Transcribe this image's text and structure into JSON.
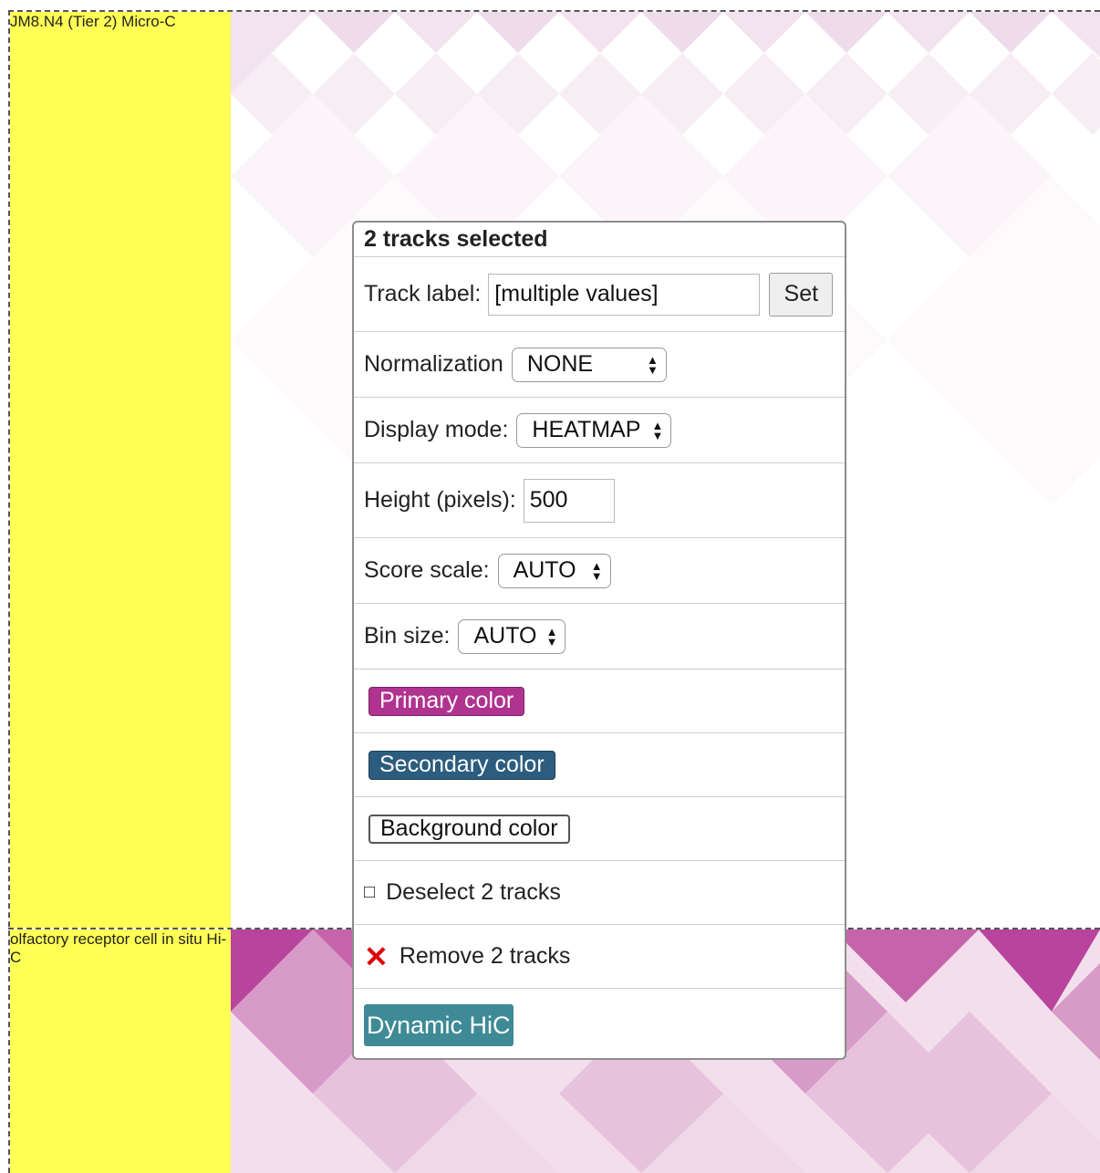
{
  "tracks": [
    {
      "label": "JM8.N4 (Tier 2) Micro-C"
    },
    {
      "label": "olfactory receptor cell in situ Hi-C"
    }
  ],
  "menu": {
    "title": "2 tracks selected",
    "track_label": {
      "label": "Track label:",
      "value": "[multiple values]",
      "set_button": "Set"
    },
    "normalization": {
      "label": "Normalization",
      "value": "NONE"
    },
    "display_mode": {
      "label": "Display mode:",
      "value": "HEATMAP"
    },
    "height": {
      "label": "Height (pixels):",
      "value": "500"
    },
    "score_scale": {
      "label": "Score scale:",
      "value": "AUTO"
    },
    "bin_size": {
      "label": "Bin size:",
      "value": "AUTO"
    },
    "primary_color": {
      "label": "Primary color",
      "color": "#b0338f"
    },
    "secondary_color": {
      "label": "Secondary color",
      "color": "#2c5d7e"
    },
    "background_color": {
      "label": "Background color",
      "color": "#ffffff"
    },
    "deselect": {
      "glyph": "□",
      "label": "Deselect 2 tracks"
    },
    "remove": {
      "glyph": "✕",
      "label": "Remove 2 tracks"
    },
    "dynamic": {
      "label": "Dynamic HiC"
    }
  },
  "colors": {
    "label_bg": "#ffff55",
    "heat_strong": "#b0338f"
  }
}
